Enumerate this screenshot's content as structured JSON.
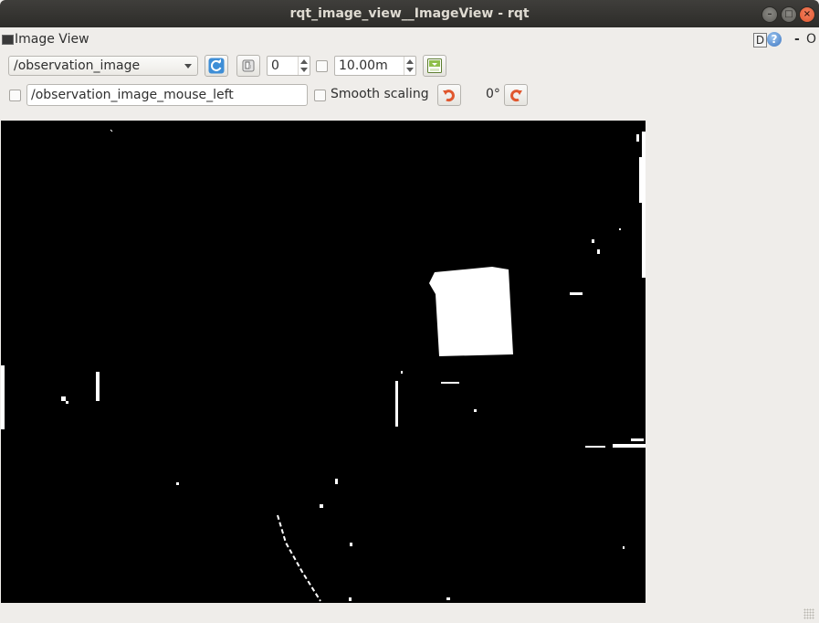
{
  "window": {
    "title": "rqt_image_view__ImageView - rqt",
    "minimize_glyph": "–",
    "maximize_glyph": "□",
    "close_glyph": "×"
  },
  "panel": {
    "title": "Image View",
    "d_button_label": "D",
    "help_label": "?",
    "minimize_label": "-",
    "float_label": "O"
  },
  "toolbar": {
    "topic": "/observation_image",
    "number_value": "0",
    "duration_value": "10.00m",
    "duration_checked": false
  },
  "toolbar2": {
    "mouse_topic_checked": false,
    "mouse_topic": "/observation_image_mouse_left",
    "smooth_scaling_label": "Smooth scaling",
    "smooth_scaling_checked": false,
    "rotation_label": "0°"
  },
  "icons": {
    "refresh": "refresh-icon",
    "zoom_fit": "zoom-fit-icon",
    "save": "save-icon",
    "rotate_left": "rotate-left-icon",
    "rotate_right": "rotate-right-icon",
    "help": "help-icon"
  },
  "colors": {
    "titlebar": "#2d2c29",
    "close_button": "#e0572e",
    "window_bg": "#efedea",
    "image_bg": "#000000",
    "image_fg": "#ffffff",
    "refresh_icon": "#3e8ed6",
    "rotate_icon": "#e0572e"
  }
}
